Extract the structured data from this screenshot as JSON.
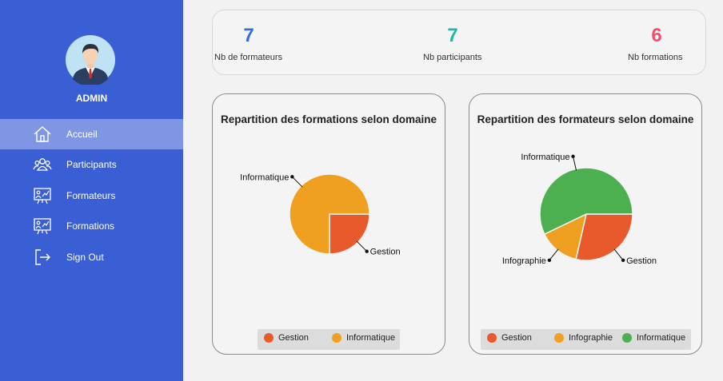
{
  "sidebar": {
    "user": "ADMIN",
    "items": [
      {
        "label": "Accueil",
        "icon": "home-icon",
        "active": true
      },
      {
        "label": "Participants",
        "icon": "users-icon",
        "active": false
      },
      {
        "label": "Formateurs",
        "icon": "presentation-icon",
        "active": false
      },
      {
        "label": "Formations",
        "icon": "presentation-icon",
        "active": false
      },
      {
        "label": "Sign Out",
        "icon": "sign-out-icon",
        "active": false
      }
    ]
  },
  "stats": [
    {
      "value": "7",
      "label": "Nb de formateurs",
      "color": "#2f6fe0"
    },
    {
      "value": "7",
      "label": "Nb participants",
      "color": "#1fb8a4"
    },
    {
      "value": "6",
      "label": "Nb formations",
      "color": "#f0506e"
    }
  ],
  "colors": {
    "sidebar_bg": "#3a5fd4",
    "gestion": "#e85a2c",
    "informatique_orange": "#f0a020",
    "infographie": "#f0a020",
    "informatique_green": "#4caf50"
  },
  "chart_data": [
    {
      "type": "pie",
      "title": "Repartition des formations selon domaine",
      "categories": [
        "Gestion",
        "Informatique"
      ],
      "values": [
        1,
        3
      ],
      "colors": [
        "#e85a2c",
        "#f0a020"
      ],
      "legend": [
        "Gestion",
        "Informatique"
      ]
    },
    {
      "type": "pie",
      "title": "Repartition des formateurs selon domaine",
      "categories": [
        "Gestion",
        "Infographie",
        "Informatique"
      ],
      "values": [
        2,
        1,
        4
      ],
      "colors": [
        "#e85a2c",
        "#f0a020",
        "#4caf50"
      ],
      "legend": [
        "Gestion",
        "Infographie",
        "Informatique"
      ]
    }
  ]
}
